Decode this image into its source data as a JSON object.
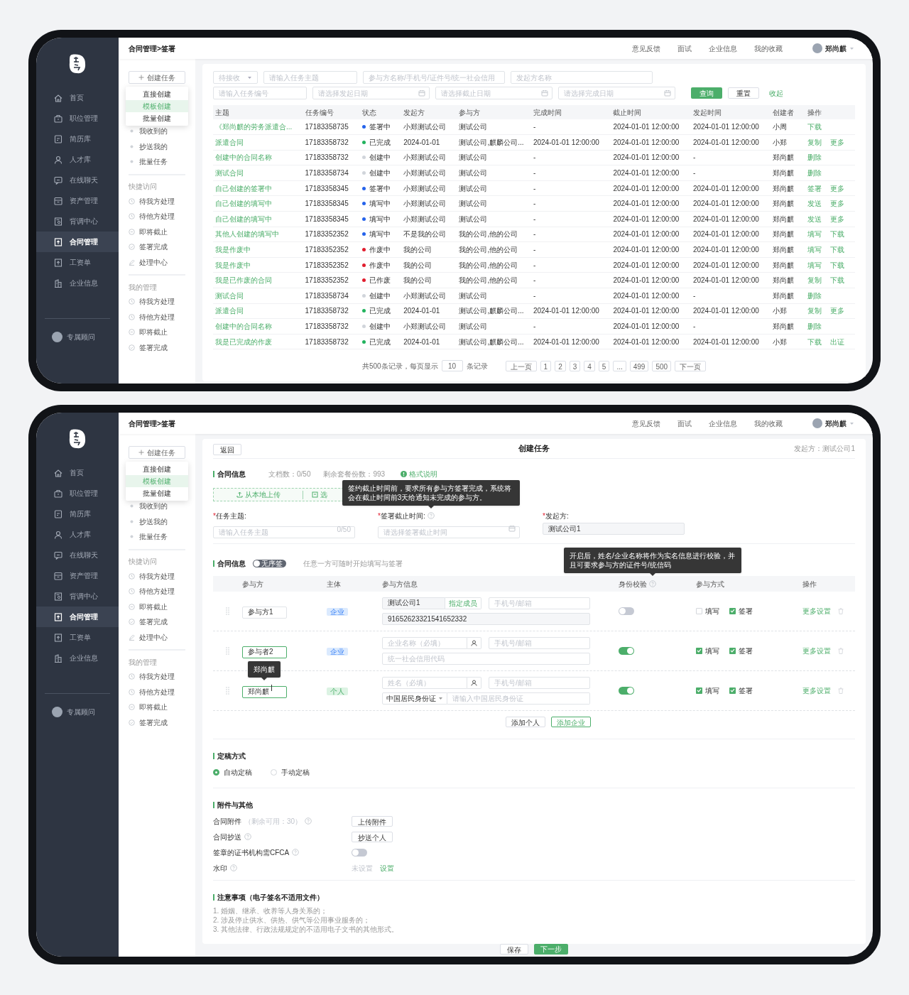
{
  "screens": [
    {
      "sidebar": {
        "items": [
          {
            "label": "首页",
            "selected": false
          },
          {
            "label": "职位管理",
            "selected": false
          },
          {
            "label": "简历库",
            "selected": false
          },
          {
            "label": "人才库",
            "selected": false
          },
          {
            "label": "在线聊天",
            "selected": false
          },
          {
            "label": "资产管理",
            "selected": false
          },
          {
            "label": "背调中心",
            "selected": false
          },
          {
            "label": "合同管理",
            "selected": true
          },
          {
            "label": "工资单",
            "selected": false
          },
          {
            "label": "企业信息",
            "selected": false
          }
        ],
        "advisor": "专属顾问"
      },
      "header": {
        "breadcrumb": "合同管理>签署",
        "links": [
          "意见反馈",
          "面试",
          "企业信息",
          "我的收藏"
        ],
        "user": "郑尚麒"
      },
      "submenu": {
        "create_button": "创建任务",
        "dropdown": [
          {
            "label": "直接创建",
            "selected": false
          },
          {
            "label": "模板创建",
            "selected": true
          },
          {
            "label": "批量创建",
            "selected": false
          }
        ],
        "groups": [
          {
            "items": [
              {
                "label": "我收到的",
                "kind": "dot"
              },
              {
                "label": "抄送我的",
                "kind": "dot"
              },
              {
                "label": "批量任务",
                "kind": "dot"
              }
            ]
          },
          {
            "title": "快捷访问",
            "items": [
              {
                "label": "待我方处理",
                "kind": "clock"
              },
              {
                "label": "待他方处理",
                "kind": "clock"
              },
              {
                "label": "即将截止",
                "kind": "minus"
              },
              {
                "label": "签署完成",
                "kind": "check"
              },
              {
                "label": "处理中心",
                "kind": "pen"
              }
            ]
          },
          {
            "title": "我的管理",
            "items": [
              {
                "label": "待我方处理",
                "kind": "clock"
              },
              {
                "label": "待他方处理",
                "kind": "clock"
              },
              {
                "label": "即将截止",
                "kind": "minus"
              },
              {
                "label": "签署完成",
                "kind": "check"
              }
            ]
          }
        ]
      },
      "filters": {
        "rows": [
          [
            {
              "kind": "select",
              "placeholder": "待接收"
            },
            {
              "kind": "text",
              "placeholder": "请输入任务主题"
            },
            {
              "kind": "text",
              "placeholder": "参与方名称/手机号/证件号/统一社会信用"
            },
            {
              "kind": "text",
              "placeholder": "发起方名称"
            }
          ],
          [
            {
              "kind": "text",
              "placeholder": "请输入任务编号"
            },
            {
              "kind": "date",
              "placeholder": "请选择发起日期"
            },
            {
              "kind": "date",
              "placeholder": "请选择截止日期"
            },
            {
              "kind": "date",
              "placeholder": "请选择完成日期"
            }
          ]
        ],
        "buttons": [
          {
            "label": "查询",
            "primary": true
          },
          {
            "label": "重置",
            "primary": false
          }
        ],
        "collapse_link": "收起"
      },
      "table": {
        "columns": [
          "主题",
          "任务编号",
          "状态",
          "发起方",
          "参与方",
          "完成时间",
          "截止时间",
          "发起时间",
          "创建者",
          "操作"
        ],
        "rows": [
          {
            "subject": "《郑尚麒的劳务派遣合...",
            "number": "17183358735",
            "status": {
              "label": "签署中",
              "color": "#2563eb"
            },
            "initiator": "小郑测试公司",
            "participants": "测试公司",
            "completed": "-",
            "deadline": "2024-01-01 12:00:00",
            "started": "2024-01-01 12:00:00",
            "creator": "小周",
            "actions": [
              "下载"
            ]
          },
          {
            "subject": "派遣合同",
            "number": "17183358732",
            "status": {
              "label": "已完成",
              "color": "#22b35e"
            },
            "initiator": "2024-01-01",
            "participants": "测试公司,麒麟公司...",
            "completed": "2024-01-01 12:00:00",
            "deadline": "2024-01-01 12:00:00",
            "started": "2024-01-01 12:00:00",
            "creator": "小郑",
            "actions": [
              "复制",
              "更多"
            ]
          },
          {
            "subject": "创建中的合同名称",
            "number": "17183358732",
            "status": {
              "label": "创建中",
              "color": "#d1d5db"
            },
            "initiator": "小郑测试公司",
            "participants": "测试公司",
            "completed": "-",
            "deadline": "2024-01-01 12:00:00",
            "started": "-",
            "creator": "郑尚麒",
            "actions": [
              "删除"
            ]
          },
          {
            "subject": "测试合同",
            "number": "17183358734",
            "status": {
              "label": "创建中",
              "color": "#d1d5db"
            },
            "initiator": "小郑测试公司",
            "participants": "测试公司",
            "completed": "-",
            "deadline": "2024-01-01 12:00:00",
            "started": "-",
            "creator": "郑尚麒",
            "actions": [
              "删除"
            ]
          },
          {
            "subject": "自己创建的签署中",
            "number": "17183358345",
            "status": {
              "label": "签署中",
              "color": "#2563eb"
            },
            "initiator": "小郑测试公司",
            "participants": "测试公司",
            "completed": "-",
            "deadline": "2024-01-01 12:00:00",
            "started": "2024-01-01 12:00:00",
            "creator": "郑尚麒",
            "actions": [
              "签署",
              "更多"
            ]
          },
          {
            "subject": "自己创建的填写中",
            "number": "17183358345",
            "status": {
              "label": "填写中",
              "color": "#2563eb"
            },
            "initiator": "小郑测试公司",
            "participants": "测试公司",
            "completed": "-",
            "deadline": "2024-01-01 12:00:00",
            "started": "2024-01-01 12:00:00",
            "creator": "郑尚麒",
            "actions": [
              "发送",
              "更多"
            ]
          },
          {
            "subject": "自己创建的填写中",
            "number": "17183358345",
            "status": {
              "label": "填写中",
              "color": "#2563eb"
            },
            "initiator": "小郑测试公司",
            "participants": "测试公司",
            "completed": "-",
            "deadline": "2024-01-01 12:00:00",
            "started": "2024-01-01 12:00:00",
            "creator": "郑尚麒",
            "actions": [
              "发送",
              "更多"
            ]
          },
          {
            "subject": "其他人创建的填写中",
            "number": "17183352352",
            "status": {
              "label": "填写中",
              "color": "#2563eb"
            },
            "initiator": "不是我的公司",
            "participants": "我的公司,他的公司",
            "completed": "-",
            "deadline": "2024-01-01 12:00:00",
            "started": "2024-01-01 12:00:00",
            "creator": "郑尚麒",
            "actions": [
              "填写",
              "下载"
            ]
          },
          {
            "subject": "我是作废中",
            "number": "17183352352",
            "status": {
              "label": "作废中",
              "color": "#e11d2e"
            },
            "initiator": "我的公司",
            "participants": "我的公司,他的公司",
            "completed": "-",
            "deadline": "2024-01-01 12:00:00",
            "started": "2024-01-01 12:00:00",
            "creator": "郑尚麒",
            "actions": [
              "填写",
              "下载"
            ]
          },
          {
            "subject": "我是作废中",
            "number": "17183352352",
            "status": {
              "label": "作废中",
              "color": "#e11d2e"
            },
            "initiator": "我的公司",
            "participants": "我的公司,他的公司",
            "completed": "-",
            "deadline": "2024-01-01 12:00:00",
            "started": "2024-01-01 12:00:00",
            "creator": "郑尚麒",
            "actions": [
              "填写",
              "下载"
            ]
          },
          {
            "subject": "我是已作废的合同",
            "number": "17183352352",
            "status": {
              "label": "已作废",
              "color": "#e11d2e"
            },
            "initiator": "我的公司",
            "participants": "我的公司,他的公司",
            "completed": "-",
            "deadline": "2024-01-01 12:00:00",
            "started": "2024-01-01 12:00:00",
            "creator": "郑尚麒",
            "actions": [
              "复制",
              "下载"
            ]
          },
          {
            "subject": "测试合同",
            "number": "17183358734",
            "status": {
              "label": "创建中",
              "color": "#d1d5db"
            },
            "initiator": "小郑测试公司",
            "participants": "测试公司",
            "completed": "-",
            "deadline": "2024-01-01 12:00:00",
            "started": "-",
            "creator": "郑尚麒",
            "actions": [
              "删除"
            ]
          },
          {
            "subject": "派遣合同",
            "number": "17183358732",
            "status": {
              "label": "已完成",
              "color": "#22b35e"
            },
            "initiator": "2024-01-01",
            "participants": "测试公司,麒麟公司...",
            "completed": "2024-01-01 12:00:00",
            "deadline": "2024-01-01 12:00:00",
            "started": "2024-01-01 12:00:00",
            "creator": "小郑",
            "actions": [
              "复制",
              "更多"
            ]
          },
          {
            "subject": "创建中的合同名称",
            "number": "17183358732",
            "status": {
              "label": "创建中",
              "color": "#d1d5db"
            },
            "initiator": "小郑测试公司",
            "participants": "测试公司",
            "completed": "-",
            "deadline": "2024-01-01 12:00:00",
            "started": "-",
            "creator": "郑尚麒",
            "actions": [
              "删除"
            ]
          },
          {
            "subject": "我是已完成的作废",
            "number": "17183358732",
            "status": {
              "label": "已完成",
              "color": "#22b35e"
            },
            "initiator": "2024-01-01",
            "participants": "测试公司,麒麟公司...",
            "completed": "2024-01-01 12:00:00",
            "deadline": "2024-01-01 12:00:00",
            "started": "2024-01-01 12:00:00",
            "creator": "小郑",
            "actions": [
              "下载",
              "出证"
            ]
          }
        ]
      },
      "pagination": {
        "total": "共500条记录，每页显示",
        "page_size": "10",
        "unit": "条记录",
        "prev": "上一页",
        "pages": [
          "1",
          "2",
          "3",
          "4",
          "5",
          "...",
          "499",
          "500"
        ],
        "next": "下一页"
      }
    },
    {
      "sidebar": {
        "items": [
          {
            "label": "首页",
            "selected": false
          },
          {
            "label": "职位管理",
            "selected": false
          },
          {
            "label": "简历库",
            "selected": false
          },
          {
            "label": "人才库",
            "selected": false
          },
          {
            "label": "在线聊天",
            "selected": false
          },
          {
            "label": "资产管理",
            "selected": false
          },
          {
            "label": "背调中心",
            "selected": false
          },
          {
            "label": "合同管理",
            "selected": true
          },
          {
            "label": "工资单",
            "selected": false
          },
          {
            "label": "企业信息",
            "selected": false
          }
        ],
        "advisor": "专属顾问"
      },
      "header": {
        "breadcrumb": "合同管理>签署",
        "links": [
          "意见反馈",
          "面试",
          "企业信息",
          "我的收藏"
        ],
        "user": "郑尚麒"
      },
      "submenu": {
        "create_button": "创建任务",
        "dropdown": [
          {
            "label": "直接创建",
            "selected": false
          },
          {
            "label": "模板创建",
            "selected": true
          },
          {
            "label": "批量创建",
            "selected": false
          }
        ],
        "groups": [
          {
            "items": [
              {
                "label": "我收到的",
                "kind": "dot"
              },
              {
                "label": "抄送我的",
                "kind": "dot"
              },
              {
                "label": "批量任务",
                "kind": "dot"
              }
            ]
          },
          {
            "title": "快捷访问",
            "items": [
              {
                "label": "待我方处理",
                "kind": "clock"
              },
              {
                "label": "待他方处理",
                "kind": "clock"
              },
              {
                "label": "即将截止",
                "kind": "minus"
              },
              {
                "label": "签署完成",
                "kind": "check"
              },
              {
                "label": "处理中心",
                "kind": "pen"
              }
            ]
          },
          {
            "title": "我的管理",
            "items": [
              {
                "label": "待我方处理",
                "kind": "clock"
              },
              {
                "label": "待他方处理",
                "kind": "clock"
              },
              {
                "label": "即将截止",
                "kind": "minus"
              },
              {
                "label": "签署完成",
                "kind": "check"
              }
            ]
          }
        ]
      },
      "form": {
        "back_button": "返回",
        "title": "创建任务",
        "initiator_note": "发起方：测试公司1",
        "doc_section": {
          "title": "合同信息",
          "stats": [
            "文档数：0/50",
            "剩余套餐份数：993"
          ],
          "help_link": "格式说明",
          "upload": {
            "local": "从本地上传",
            "other": "选"
          }
        },
        "fields": [
          {
            "label": "任务主题:",
            "required_mark": "*",
            "kind": "text",
            "placeholder": "请输入任务主题",
            "counter": "0/50"
          },
          {
            "label": "签署截止时间:",
            "required_mark": "*",
            "kind": "date",
            "placeholder": "请选择签署截止时间",
            "tooltip": "签约截止时间前，要求所有参与方签署完成，系统将会在截止时间前3天给通知未完成的参与方。"
          },
          {
            "label": "发起方:",
            "required_mark": "*",
            "kind": "readonly",
            "value": "测试公司1"
          }
        ],
        "party_section": {
          "title": "合同信息",
          "toggle": {
            "label": "无序签",
            "on": false
          },
          "note": "任意一方可随时开始填写与签署",
          "columns": [
            {
              "label": "参与方"
            },
            {
              "label": "主体"
            },
            {
              "label": "参与方信息"
            },
            {
              "label": "身份校验",
              "tooltip": "开启后，姓名/企业名称将作为实名信息进行校验，并且可要求参与方的证件号/统信码"
            },
            {
              "label": "参与方式"
            },
            {
              "label": "操作"
            }
          ],
          "participants": [
            {
              "name": "参与方1",
              "highlighted": false,
              "focused": false,
              "subject": {
                "label": "企业",
                "kind": "company"
              },
              "info": {
                "kind": "company",
                "name_value": "测试公司1",
                "member_button": "指定成员",
                "contact_placeholder": "手机号/邮箱",
                "code_value": "91652623321541652332"
              },
              "verify": false,
              "methods": [
                {
                  "label": "填写",
                  "checked": false
                },
                {
                  "label": "签署",
                  "checked": true
                }
              ],
              "more": "更多设置"
            },
            {
              "name": "参与者2",
              "highlighted": true,
              "focused": false,
              "subject": {
                "label": "企业",
                "kind": "company"
              },
              "info": {
                "kind": "company",
                "name_placeholder": "企业名称（必填）",
                "contact_placeholder": "手机号/邮箱",
                "code_placeholder": "统一社会信用代码"
              },
              "verify": true,
              "methods": [
                {
                  "label": "填写",
                  "checked": true
                },
                {
                  "label": "签署",
                  "checked": true
                }
              ],
              "more": "更多设置"
            },
            {
              "name": "郑尚麒",
              "highlighted": true,
              "focused": true,
              "tooltip": "郑尚麒",
              "subject": {
                "label": "个人",
                "kind": "person"
              },
              "info": {
                "kind": "person",
                "name_placeholder": "姓名（必填）",
                "contact_placeholder": "手机号/邮箱",
                "id_type": "中国居民身份证",
                "id_placeholder": "请输入中国居民身份证"
              },
              "verify": true,
              "methods": [
                {
                  "label": "填写",
                  "checked": true
                },
                {
                  "label": "签署",
                  "checked": true
                }
              ],
              "more": "更多设置"
            }
          ],
          "add_buttons": [
            {
              "label": "添加个人",
              "primary": false
            },
            {
              "label": "添加企业",
              "primary": true
            }
          ]
        },
        "finalize": {
          "title": "定稿方式",
          "options": [
            {
              "label": "自动定稿",
              "selected": true
            },
            {
              "label": "手动定稿",
              "selected": false
            }
          ]
        },
        "attachments": {
          "title": "附件与其他",
          "rows": [
            {
              "label": "合同附件",
              "hint": "（剩余可用：30）",
              "kind": "button",
              "button": "上传附件"
            },
            {
              "label": "合同抄送",
              "kind": "button",
              "button": "抄送个人"
            },
            {
              "label": "签章的证书机构需CFCA",
              "kind": "toggle",
              "on": false
            },
            {
              "label": "水印",
              "kind": "setting",
              "status": "未设置",
              "link": "设置"
            }
          ]
        },
        "notes": {
          "title": "注意事项（电子签名不适用文件）",
          "lines": [
            "1. 婚姻、继承、收养等人身关系的；",
            "2. 涉及停止供水、供热、供气等公用事业服务的；",
            "3. 其他法律、行政法规规定的不适用电子文书的其他形式。"
          ]
        },
        "footer": [
          {
            "label": "保存",
            "primary": false
          },
          {
            "label": "下一步",
            "primary": true
          }
        ]
      }
    }
  ]
}
